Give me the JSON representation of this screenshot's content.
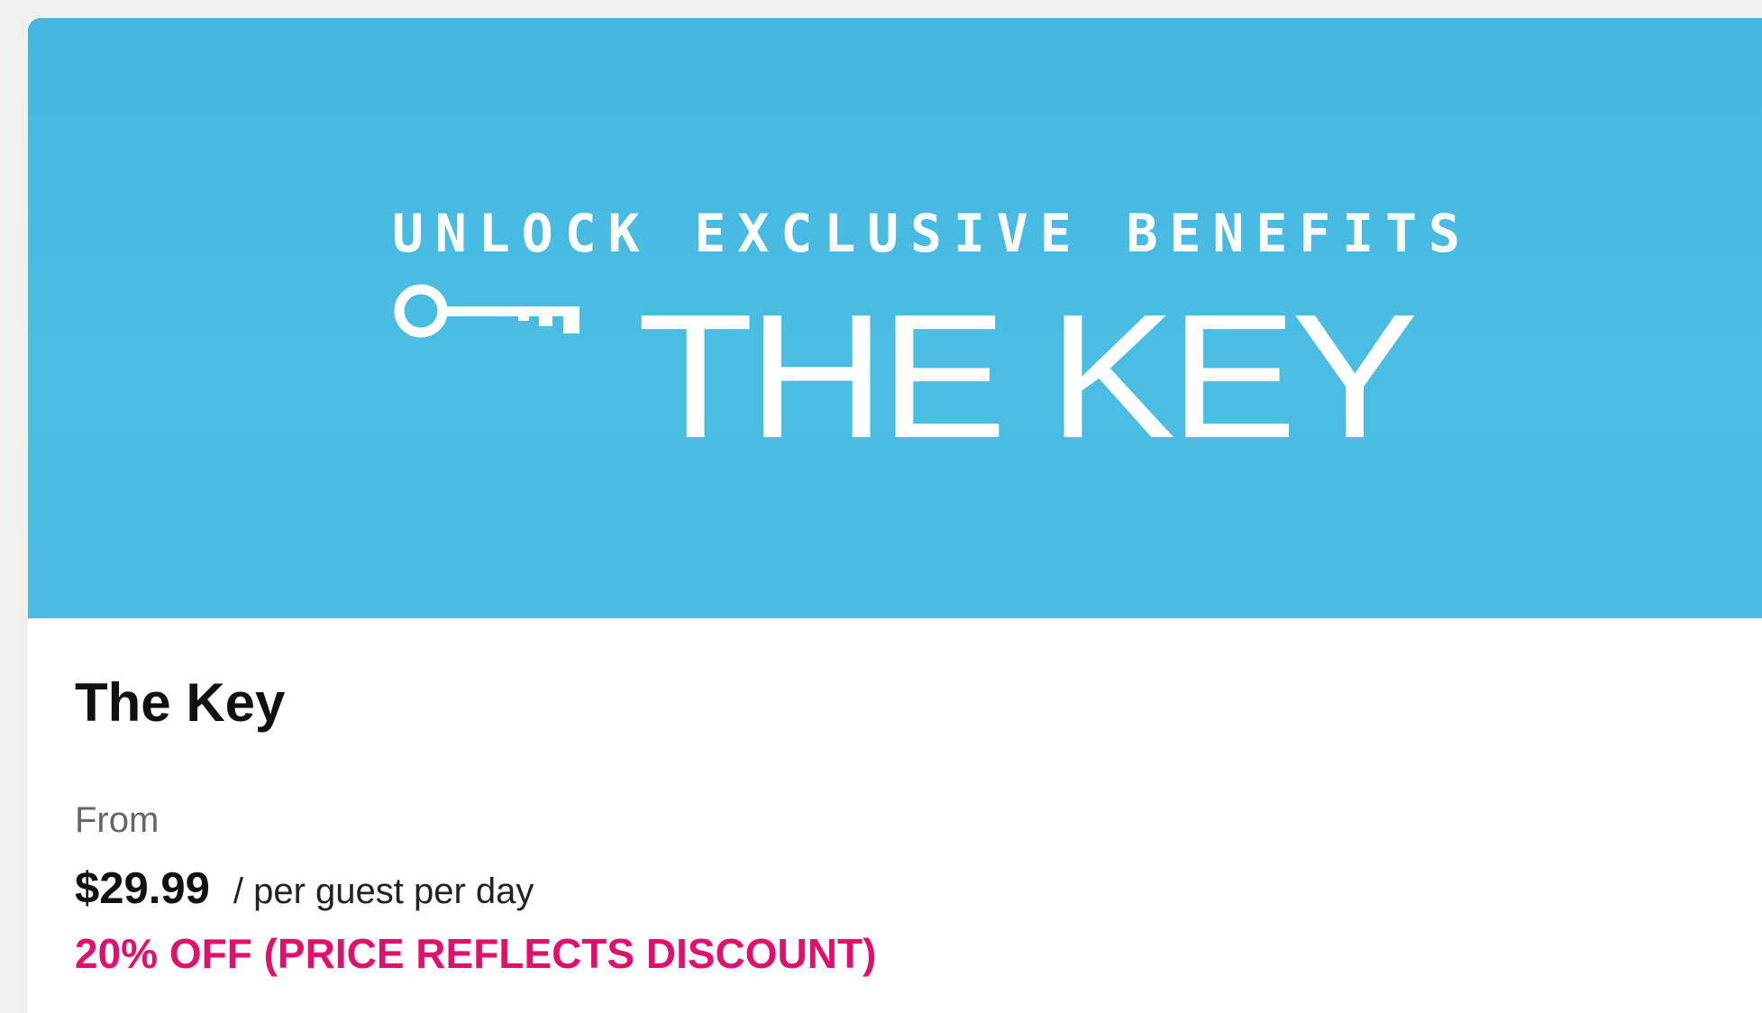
{
  "banner": {
    "tagline": "UNLOCK EXCLUSIVE BENEFITS",
    "brand": "THE KEY",
    "icon": "key-icon",
    "background_color": "#4bbbe0"
  },
  "product": {
    "title": "The Key",
    "from_label": "From",
    "price": "$29.99",
    "price_unit": "/ per guest per day",
    "discount": "20% OFF (PRICE REFLECTS DISCOUNT)",
    "discount_color": "#e0116c"
  }
}
